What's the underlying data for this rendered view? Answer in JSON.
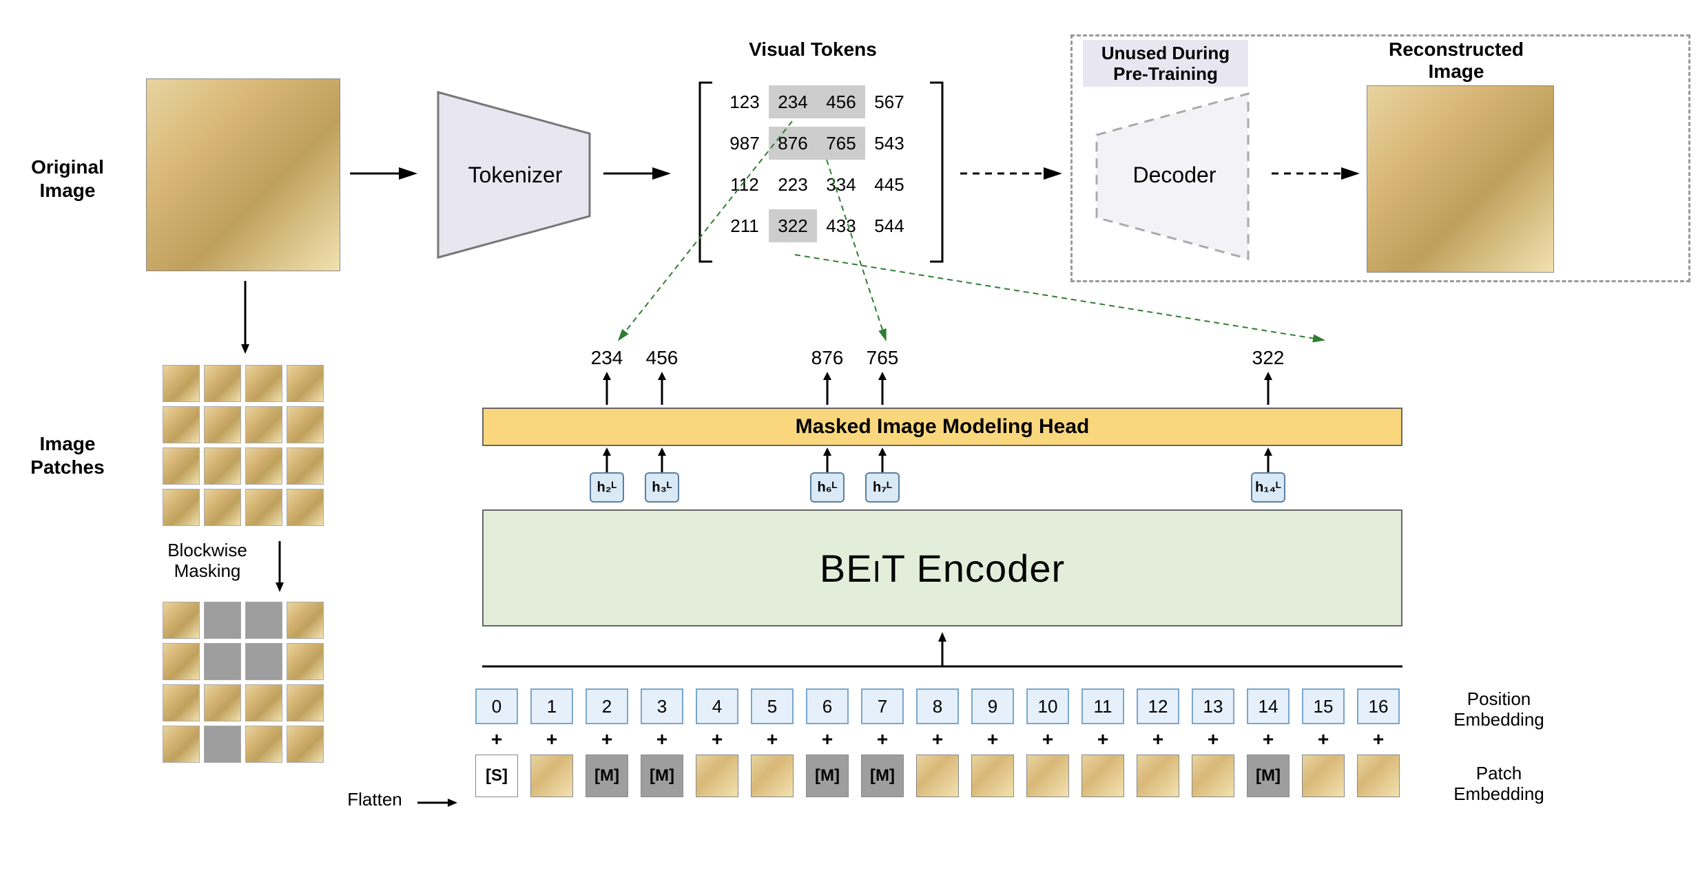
{
  "labels": {
    "original_image": "Original\nImage",
    "image_patches": "Image\nPatches",
    "blockwise_masking": "Blockwise\nMasking",
    "flatten": "Flatten",
    "tokenizer": "Tokenizer",
    "visual_tokens": "Visual Tokens",
    "decoder": "Decoder",
    "unused": "Unused During\nPre-Training",
    "reconstructed": "Reconstructed\nImage",
    "mim_head": "Masked Image Modeling Head",
    "encoder": "BEIT Encoder",
    "position_embedding": "Position\nEmbedding",
    "patch_embedding": "Patch\nEmbedding"
  },
  "token_grid": {
    "rows": [
      [
        "123",
        "234",
        "456",
        "567"
      ],
      [
        "987",
        "876",
        "765",
        "543"
      ],
      [
        "112",
        "223",
        "334",
        "445"
      ],
      [
        "211",
        "322",
        "433",
        "544"
      ]
    ],
    "highlighted": [
      [
        0,
        1
      ],
      [
        0,
        2
      ],
      [
        1,
        1
      ],
      [
        1,
        2
      ],
      [
        3,
        1
      ]
    ]
  },
  "predictions": [
    {
      "pos": 2,
      "val": "234",
      "h": "h₂ᴸ"
    },
    {
      "pos": 3,
      "val": "456",
      "h": "h₃ᴸ"
    },
    {
      "pos": 6,
      "val": "876",
      "h": "h₆ᴸ"
    },
    {
      "pos": 7,
      "val": "765",
      "h": "h₇ᴸ"
    },
    {
      "pos": 14,
      "val": "322",
      "h": "h₁₄ᴸ"
    }
  ],
  "position_indices": [
    "0",
    "1",
    "2",
    "3",
    "4",
    "5",
    "6",
    "7",
    "8",
    "9",
    "10",
    "11",
    "12",
    "13",
    "14",
    "15",
    "16"
  ],
  "patch_sequence": [
    {
      "type": "start",
      "text": "[S]"
    },
    {
      "type": "img"
    },
    {
      "type": "mask",
      "text": "[M]"
    },
    {
      "type": "mask",
      "text": "[M]"
    },
    {
      "type": "img"
    },
    {
      "type": "img"
    },
    {
      "type": "mask",
      "text": "[M]"
    },
    {
      "type": "mask",
      "text": "[M]"
    },
    {
      "type": "img"
    },
    {
      "type": "img"
    },
    {
      "type": "img"
    },
    {
      "type": "img"
    },
    {
      "type": "img"
    },
    {
      "type": "img"
    },
    {
      "type": "mask",
      "text": "[M]"
    },
    {
      "type": "img"
    },
    {
      "type": "img"
    }
  ],
  "masked_grid": [
    [
      false,
      true,
      true,
      false
    ],
    [
      false,
      true,
      true,
      false
    ],
    [
      false,
      false,
      false,
      false
    ],
    [
      false,
      true,
      false,
      false
    ]
  ],
  "colors": {
    "mim_bg": "#fad77c",
    "encoder_bg": "#e2eed9",
    "pos_bg": "#e6f0fa",
    "mask_gray": "#9e9e9e",
    "trapezoid_bg": "#e8e6f0"
  }
}
